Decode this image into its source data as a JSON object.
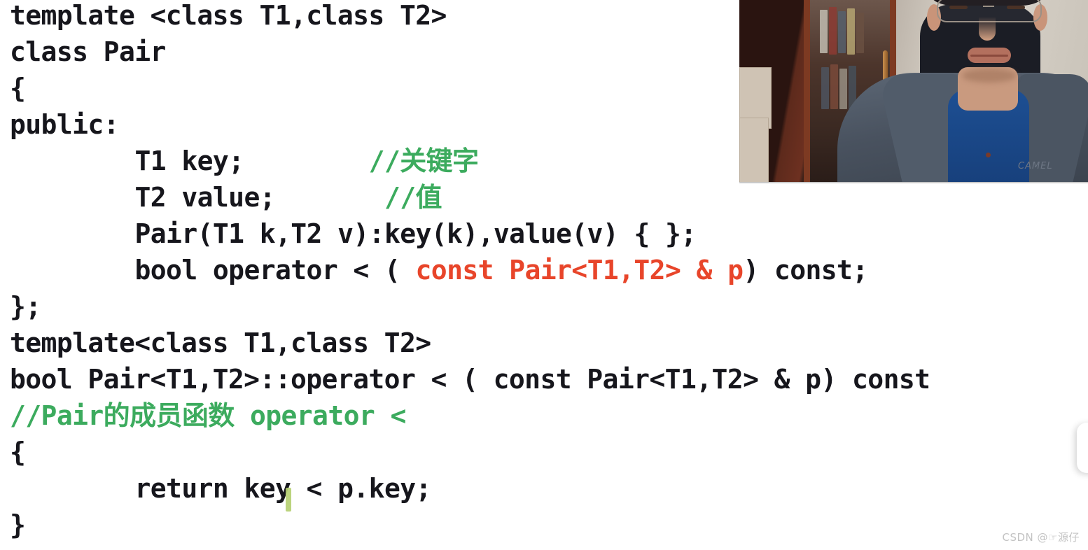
{
  "document": {
    "type": "code-slide",
    "language": "C++",
    "background_color": "#ffffff",
    "text_color": "#16161c",
    "comment_color": "#3cab5e",
    "highlight_color": "#e8452a"
  },
  "code": {
    "lines": [
      {
        "indent": 0,
        "segments": [
          {
            "text": "template <class T1,class T2>",
            "style": "plain"
          }
        ]
      },
      {
        "indent": 0,
        "segments": [
          {
            "text": "class Pair",
            "style": "plain"
          }
        ]
      },
      {
        "indent": 0,
        "segments": [
          {
            "text": "{",
            "style": "plain"
          }
        ]
      },
      {
        "indent": 0,
        "segments": [
          {
            "text": "public:",
            "style": "plain"
          }
        ]
      },
      {
        "indent": 7,
        "segments": [
          {
            "text": "T1 key;        ",
            "style": "plain"
          },
          {
            "text": "//关键字",
            "style": "comment"
          }
        ]
      },
      {
        "indent": 7,
        "segments": [
          {
            "text": "T2 value;       ",
            "style": "plain"
          },
          {
            "text": "//值",
            "style": "comment"
          }
        ]
      },
      {
        "indent": 7,
        "segments": [
          {
            "text": "Pair(T1 k,T2 v):key(k),value(v) { };",
            "style": "plain"
          }
        ]
      },
      {
        "indent": 7,
        "segments": [
          {
            "text": "bool operator < ( ",
            "style": "plain"
          },
          {
            "text": "const Pair<T1,T2> & p",
            "style": "highlight"
          },
          {
            "text": ") const;",
            "style": "plain"
          }
        ]
      },
      {
        "indent": 0,
        "segments": [
          {
            "text": "};",
            "style": "plain"
          }
        ]
      },
      {
        "indent": 0,
        "segments": [
          {
            "text": "template<class T1,class T2>",
            "style": "plain"
          }
        ]
      },
      {
        "indent": 0,
        "segments": [
          {
            "text": "bool Pair<T1,T2>::operator < ( const Pair<T1,T2> & p) const",
            "style": "plain"
          }
        ]
      },
      {
        "indent": 0,
        "segments": [
          {
            "text": "//Pair的成员函数 operator <",
            "style": "comment"
          }
        ]
      },
      {
        "indent": 0,
        "segments": [
          {
            "text": "{",
            "style": "plain"
          }
        ]
      },
      {
        "indent": 7,
        "segments": [
          {
            "text": "return key < p.key;",
            "style": "plain"
          }
        ]
      },
      {
        "indent": 0,
        "segments": [
          {
            "text": "}",
            "style": "plain"
          }
        ]
      }
    ]
  },
  "webcam": {
    "label": "presenter-video-overlay",
    "jacket_brand_text": "CAMEL",
    "description": "presenter on video call"
  },
  "caret": {
    "label": "text-cursor"
  },
  "side_card": {
    "label": "partially-visible-panel"
  },
  "watermark": {
    "text": "CSDN @☞源仔"
  }
}
